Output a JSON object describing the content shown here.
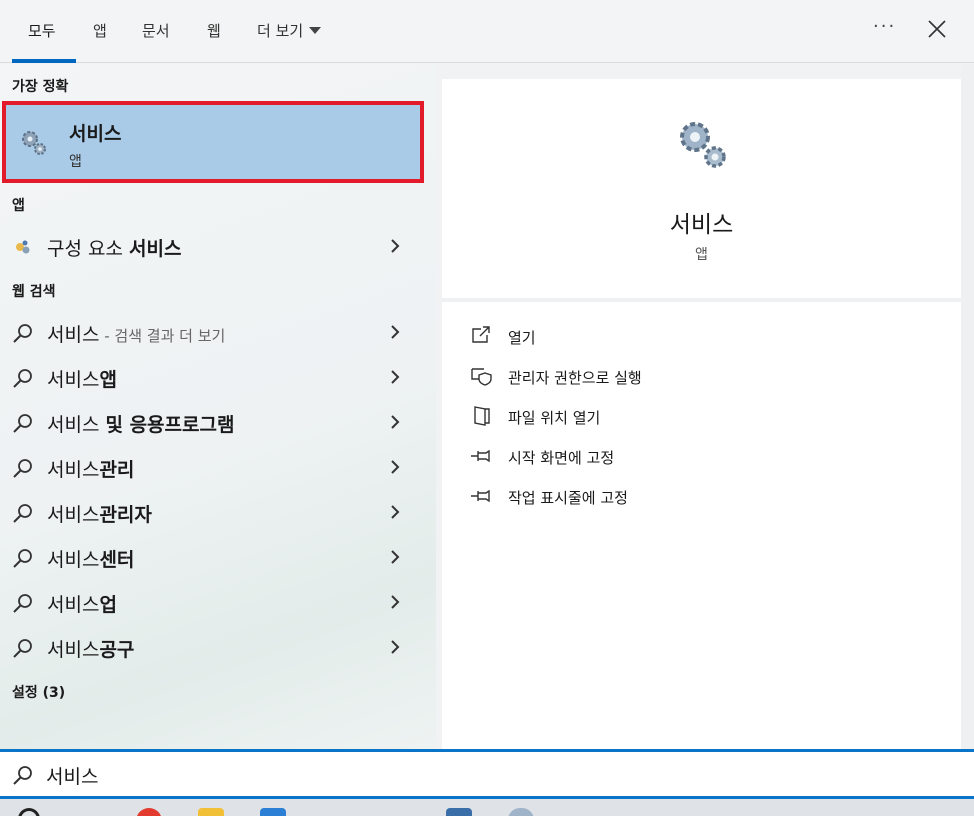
{
  "tabs": [
    {
      "label": "모두",
      "active": true
    },
    {
      "label": "앱"
    },
    {
      "label": "문서"
    },
    {
      "label": "웹"
    },
    {
      "label": "더 보기"
    }
  ],
  "header": {
    "more_icon": "ellipsis-icon",
    "close_icon": "close-icon"
  },
  "sections": {
    "best_match": "가장 정확",
    "apps": "앱",
    "web": "웹 검색",
    "settings": "설정 (3)"
  },
  "best_match": {
    "title": "서비스",
    "subtitle": "앱",
    "icon": "gears-icon"
  },
  "apps": [
    {
      "prefix": "구성 요소 ",
      "bold": "서비스",
      "icon": "component-services-icon"
    }
  ],
  "web_results": [
    {
      "prefix": "서비스",
      "bold": "",
      "hint": " - 검색 결과 더 보기"
    },
    {
      "prefix": "서비스",
      "bold": "앱",
      "hint": ""
    },
    {
      "prefix": "서비스 ",
      "bold": "및 응용프로그램",
      "hint": ""
    },
    {
      "prefix": "서비스",
      "bold": "관리",
      "hint": ""
    },
    {
      "prefix": "서비스",
      "bold": "관리자",
      "hint": ""
    },
    {
      "prefix": "서비스",
      "bold": "센터",
      "hint": ""
    },
    {
      "prefix": "서비스",
      "bold": "업",
      "hint": ""
    },
    {
      "prefix": "서비스",
      "bold": "공구",
      "hint": ""
    }
  ],
  "detail": {
    "title": "서비스",
    "subtitle": "앱",
    "actions": [
      {
        "label": "열기",
        "icon": "open-icon"
      },
      {
        "label": "관리자 권한으로 실행",
        "icon": "shield-icon"
      },
      {
        "label": "파일 위치 열기",
        "icon": "file-location-icon"
      },
      {
        "label": "시작 화면에 고정",
        "icon": "pin-icon"
      },
      {
        "label": "작업 표시줄에 고정",
        "icon": "pin-icon"
      }
    ]
  },
  "search": {
    "value": "서비스",
    "icon": "search-icon"
  },
  "colors": {
    "accent": "#0067c0",
    "selection": "#a9cbe8",
    "highlight_border": "#e21a2a"
  }
}
